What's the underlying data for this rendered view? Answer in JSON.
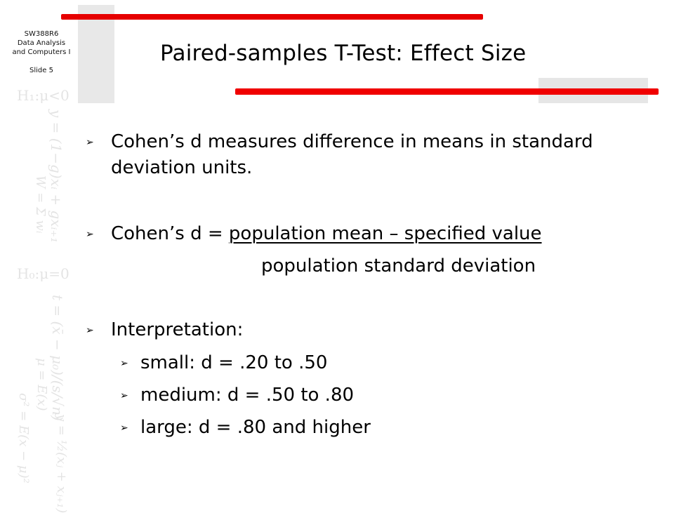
{
  "course": {
    "code": "SW388R6",
    "line2": "Data Analysis",
    "line3": "and Computers I",
    "slide_label": "Slide 5"
  },
  "watermark": {
    "h1": "H₁:μ<0",
    "h0": "H₀:μ=0",
    "formula1": "y = (1−g)xᵢ + gxᵢ₊₁",
    "formula2": "W = Σ wᵢ",
    "formula3": "t = (x̄ − μ₀)/(s/√n)",
    "formula4": "μ = E(x)",
    "formula5": "σ² = E(x − μ)²",
    "formula6": "y = ½(xⱼ + xⱼ₊₁)"
  },
  "colors": {
    "accent_red": "#e60000",
    "decor_gray": "#e8e8e8"
  },
  "slide": {
    "title": "Paired-samples T-Test: Effect Size",
    "bullets": [
      {
        "line1": "Cohen’s d measures difference in means in standard",
        "line2": "deviation units."
      },
      {
        "prefix": "Cohen’s d = ",
        "numerator": "population mean – specified value",
        "denominator": "population standard deviation"
      },
      {
        "label": "Interpretation:",
        "sub_items": [
          "small: d = .20 to .50",
          "medium: d = .50 to .80",
          "large: d = .80 and higher"
        ]
      }
    ],
    "bullet_icon": "arrowhead-bullet-icon",
    "bullet_glyph": "➢"
  }
}
